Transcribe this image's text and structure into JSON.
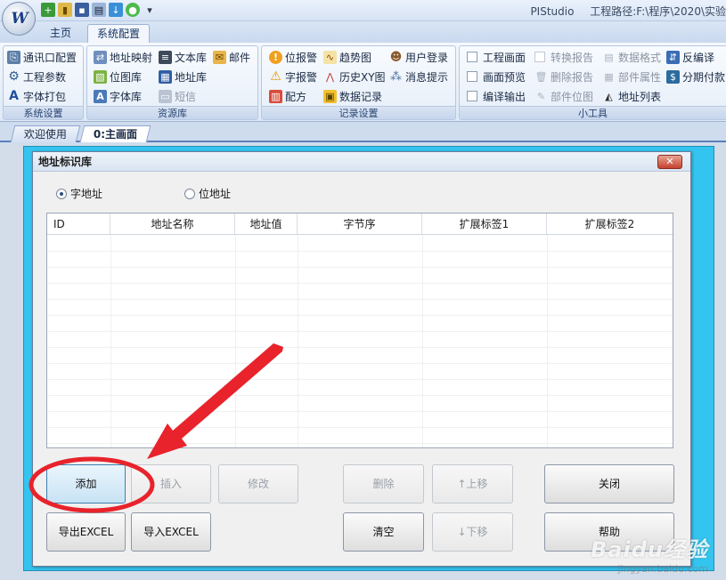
{
  "window": {
    "app_name": "PIStudio",
    "project_path": "工程路径:F:\\程序\\2020\\实验"
  },
  "ribbon_tabs": [
    "主页",
    "系统配置"
  ],
  "ribbon": {
    "system_settings": {
      "label": "系统设置",
      "items": [
        "通讯口配置",
        "工程参数",
        "字体打包"
      ]
    },
    "resource_lib": {
      "label": "资源库",
      "col1": [
        "地址映射",
        "位图库",
        "字体库"
      ],
      "col2": [
        "文本库",
        "地址库",
        "短信"
      ],
      "col3": [
        "邮件"
      ]
    },
    "record_settings": {
      "label": "记录设置",
      "col1": [
        "位报警",
        "字报警",
        "配方"
      ],
      "col2": [
        "趋势图",
        "历史XY图",
        "数据记录"
      ],
      "col3": [
        "用户登录",
        "消息提示"
      ]
    },
    "tools": {
      "label": "小工具",
      "col1": [
        "工程画面",
        "画面预览",
        "编译输出"
      ],
      "col2": [
        "转换报告",
        "删除报告",
        "部件位图"
      ],
      "col3": [
        "数据格式",
        "部件属性",
        "地址列表"
      ],
      "col4": [
        "反编译",
        "分期付款"
      ]
    }
  },
  "doc_tabs": [
    "欢迎使用",
    "0:主画面"
  ],
  "dialog": {
    "title": "地址标识库",
    "close_label": "✕",
    "radio_word": "字地址",
    "radio_bit": "位地址",
    "columns": [
      "ID",
      "地址名称",
      "地址值",
      "字节序",
      "扩展标签1",
      "扩展标签2"
    ],
    "buttons": {
      "add": "添加",
      "insert": "插入",
      "modify": "修改",
      "delete": "删除",
      "move_up": "↑上移",
      "close": "关闭",
      "export_excel": "导出EXCEL",
      "import_excel": "导入EXCEL",
      "clear": "清空",
      "move_down": "↓下移",
      "help": "帮助"
    }
  },
  "watermark": {
    "main": "Baidu经验",
    "sub": "jingyan.baidu.com"
  },
  "colors": {
    "canvas_cyan": "#34c4f0",
    "annotation_red": "#e8232b"
  },
  "icons": [
    "app-logo-icon",
    "new-icon",
    "open-icon",
    "save-icon",
    "export-icon",
    "compile-icon",
    "run-icon"
  ]
}
